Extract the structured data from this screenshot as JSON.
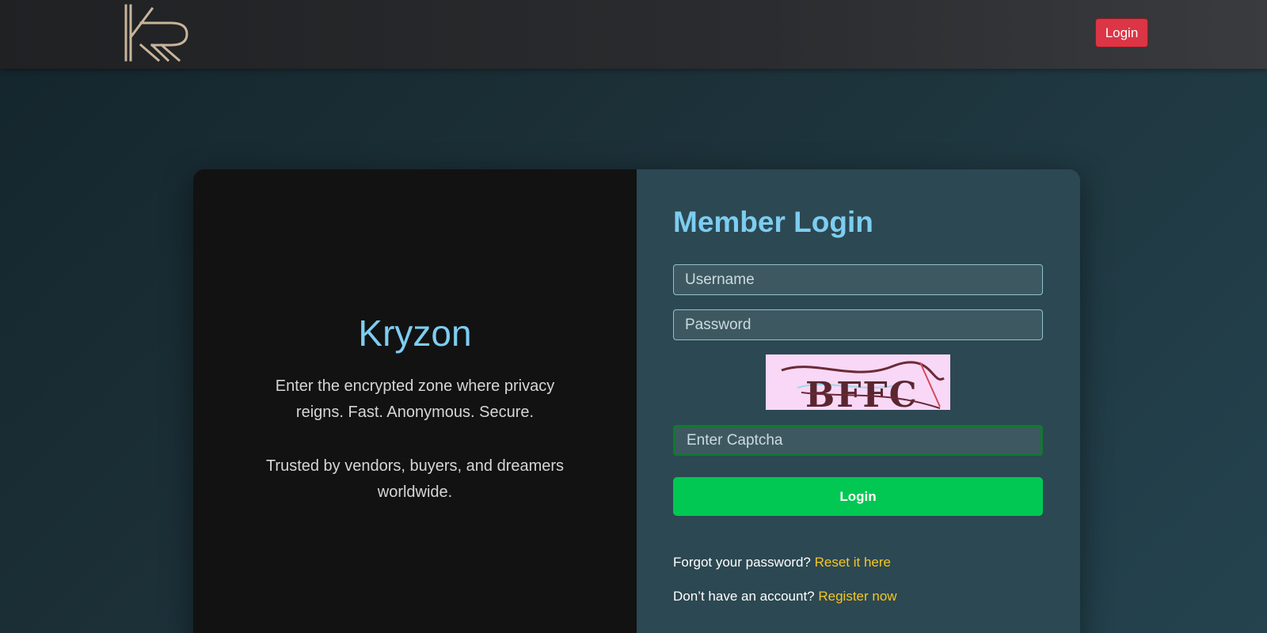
{
  "header": {
    "login_button": "Login"
  },
  "brand": {
    "name": "Kryzon",
    "tagline": "Enter the encrypted zone where privacy reigns. Fast. Anonymous. Secure.",
    "trust": "Trusted by vendors, buyers, and dreamers worldwide."
  },
  "login": {
    "title": "Member Login",
    "username_placeholder": "Username",
    "password_placeholder": "Password",
    "captcha_placeholder": "Enter Captcha",
    "captcha_text": "BFFC",
    "submit": "Login",
    "forgot_text": "Forgot your password? ",
    "forgot_link": "Reset it here",
    "register_text": "Don’t have an account? ",
    "register_link": "Register now"
  },
  "colors": {
    "accent": "#7dcdf1",
    "success": "#00c853",
    "danger": "#dc3545",
    "link": "#f6c622"
  },
  "icons": {
    "logo": "kr-logo"
  }
}
